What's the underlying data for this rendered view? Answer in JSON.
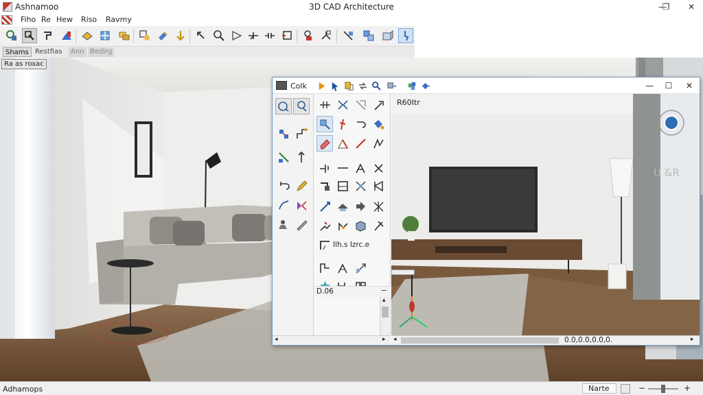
{
  "app": {
    "name": "Ashnamoo",
    "window_title": "3D CAD Architecture",
    "controls": [
      "—",
      "❐",
      "✕"
    ]
  },
  "menu": {
    "items": [
      "Fiho",
      "Re",
      "Hew",
      "Riso",
      "Ravmy"
    ]
  },
  "toolbar": {
    "icons": [
      "snap-icon",
      "select-icon",
      "wall-icon",
      "column-icon",
      "slab-icon",
      "window-icon",
      "door-icon",
      "stairs-icon",
      "paint-icon",
      "move-icon",
      "rotate-icon",
      "zoom-icon",
      "measure-icon",
      "trim-icon",
      "extend-icon",
      "light-icon",
      "camera-icon",
      "section-icon",
      "render-icon",
      "settings-icon",
      "pointer-icon"
    ]
  },
  "view_tabs": [
    "Shams",
    "Restfias",
    "Ann",
    "Bedirg"
  ],
  "viewport": {
    "label": "Ra as roxac"
  },
  "palette": {
    "title": "Colk",
    "controls": [
      "—",
      "☐",
      "✕"
    ],
    "row_label": "Ilh.s Izrc.e",
    "list_label": "D.06",
    "list_minus": "−",
    "view_label": "R60Itr",
    "coordinates": "0.0,0.0,0.0,0.",
    "scroll_left": "◂",
    "scroll_right": "▸",
    "scroll_up": "▴",
    "scroll_down": "▾"
  },
  "status": {
    "text": "Adhamops",
    "mode": "Narte",
    "zoom_minus": "−",
    "zoom_plus": "+",
    "zoom_level": 0.5
  },
  "colors": {
    "accent": "#2f6db5",
    "wall": "#e8e8e6",
    "floor": "#7a5a3d",
    "sofa": "#b3b0a9"
  }
}
